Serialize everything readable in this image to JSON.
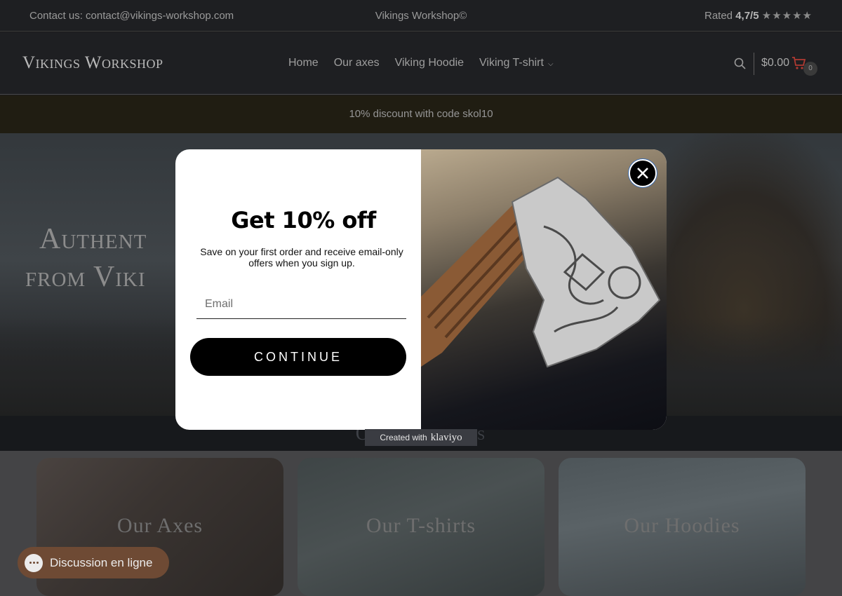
{
  "topbar": {
    "contact": "Contact us: contact@vikings-workshop.com",
    "brand": "Vikings Workshop©",
    "rating_prefix": "Rated ",
    "rating_value": "4,7/5",
    "rating_stars": "★★★★★"
  },
  "header": {
    "logo": "Vikings Workshop",
    "nav": [
      {
        "label": "Home"
      },
      {
        "label": "Our axes"
      },
      {
        "label": "Viking Hoodie"
      },
      {
        "label": "Viking T-shirt"
      }
    ],
    "cart_total": "$0.00",
    "cart_count": "0"
  },
  "promo": {
    "text": "10% discount with code skol10"
  },
  "hero": {
    "title_line1": "Authent",
    "title_line2": "from Viki"
  },
  "collections": {
    "title": "Our Vi                  ctions",
    "cards": [
      {
        "label": "Our Axes"
      },
      {
        "label": "Our T-shirts"
      },
      {
        "label": "Our Hoodies"
      }
    ]
  },
  "chat": {
    "label": "Discussion en ligne"
  },
  "modal": {
    "title": "Get 10% off",
    "subtitle": "Save on your first order and receive email-only offers when you sign up.",
    "email_placeholder": "Email",
    "button": "CONTINUE",
    "footer_prefix": "Created with",
    "footer_brand": "klaviyo"
  },
  "colors": {
    "accent_cart": "#b03a32",
    "chat_bg": "#6e4a34",
    "button_bg": "#000000"
  },
  "icons": [
    "search-icon",
    "cart-icon",
    "chevron-down-icon",
    "close-icon",
    "chat-bubble-icon"
  ]
}
